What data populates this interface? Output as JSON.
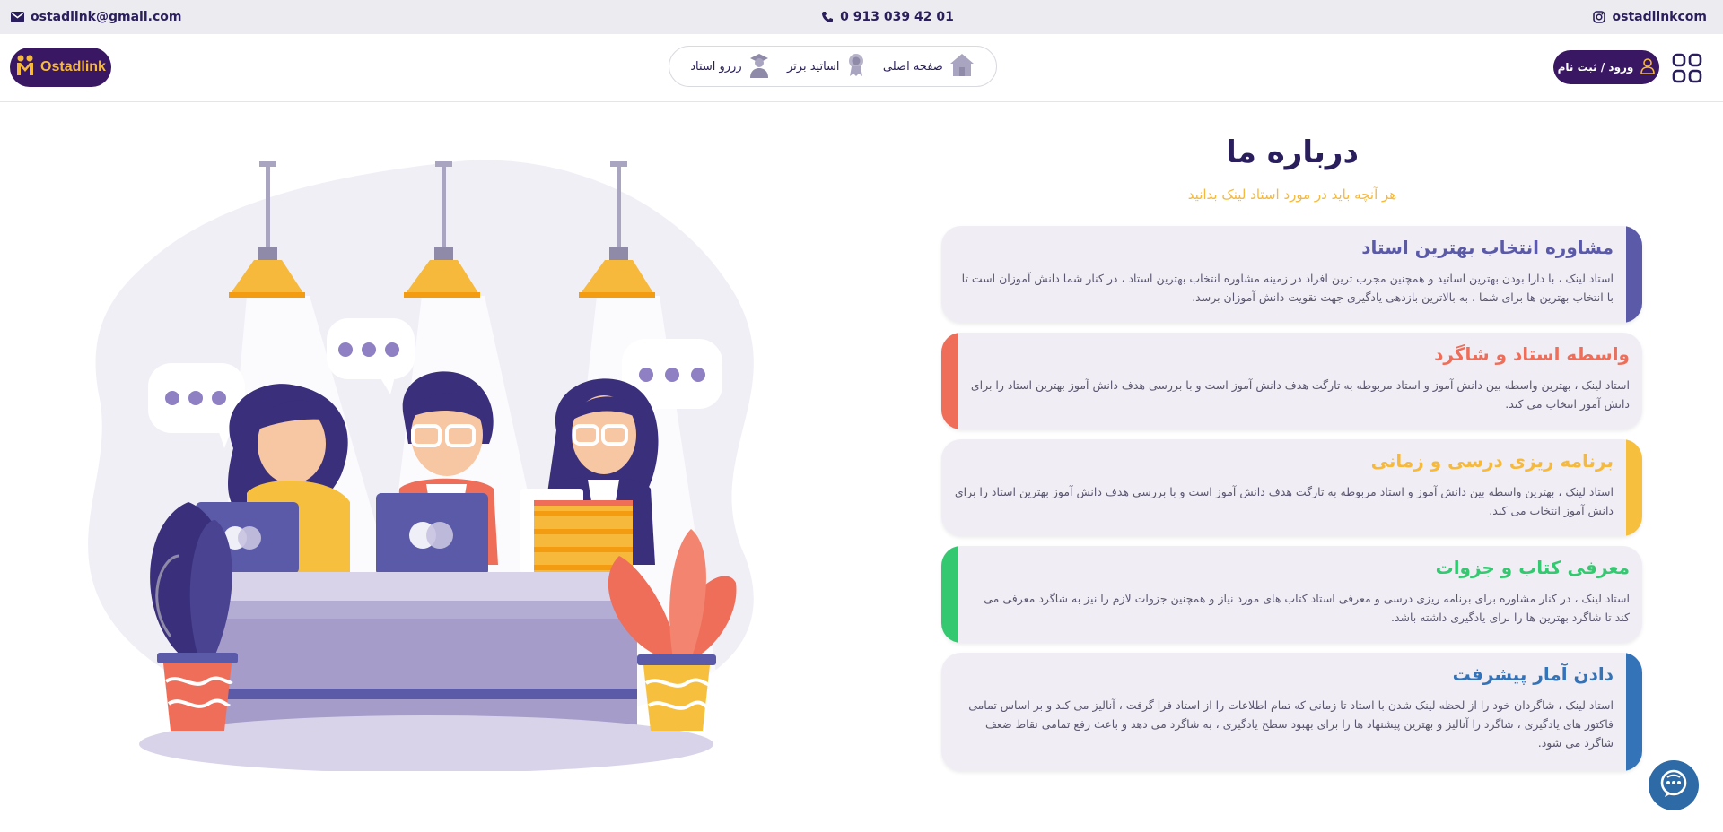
{
  "topbar": {
    "email": "ostadlink@gmail.com",
    "phone": "0 913 039 42 01",
    "instagram": "ostadlinkcom"
  },
  "header": {
    "logo_text": "Ostadlink",
    "nav": [
      {
        "label": "صفحه اصلی"
      },
      {
        "label": "اساتید برتر"
      },
      {
        "label": "رزرو استاد"
      }
    ],
    "login_label": "ورود / ثبت نام"
  },
  "about": {
    "title": "درباره ما",
    "subtitle": "هر آنچه باید در مورد استاد لینک بدانید",
    "cards": [
      {
        "title": "مشاوره انتخاب بهترین استاد",
        "text": "استاد لینک ، با دارا بودن بهترین اساتید و همچنین مجرب ترین افراد در زمینه مشاوره انتخاب بهترین استاد ، در کنار شما دانش آموزان است تا با انتخاب بهترین ها برای شما ، به بالاترین بازدهی یادگیری جهت تقویت دانش آموزان برسد.",
        "color": "#5b5aa8",
        "side": "right"
      },
      {
        "title": "واسطه استاد و شاگرد",
        "text": "استاد لینک ، بهترین واسطه بین دانش آموز و استاد مربوطه به تارگت هدف دانش آموز است و با بررسی هدف دانش آموز بهترین استاد را برای دانش آموز انتخاب می کند.",
        "color": "#ee6e5a",
        "side": "left"
      },
      {
        "title": "برنامه ریزی درسی و زمانی",
        "text": "استاد لینک ، بهترین واسطه بین دانش آموز و استاد مربوطه به تارگت هدف دانش آموز است و با بررسی هدف دانش آموز بهترین استاد را برای دانش آموز انتخاب می کند.",
        "color": "#f6c03e",
        "side": "right"
      },
      {
        "title": "معرفی کتاب و جزوات",
        "text": "استاد لینک ، در کنار مشاوره برای برنامه ریزی درسی و معرفی استاد کتاب های مورد نیاز و همچنین جزوات لازم را نیز به شاگرد معرفی می کند تا شاگرد بهترین ها را برای یادگیری داشته باشد.",
        "color": "#34c970",
        "side": "left"
      },
      {
        "title": "دادن آمار پیشرفت",
        "text": "استاد لینک ، شاگردان خود را از لحظه لینک شدن با استاد تا زمانی که تمام اطلاعات را از استاد فرا گرفت ، آنالیز می کند و بر اساس تمامی فاکتور های یادگیری ، شاگرد را آنالیز و بهترین پیشنهاد ها را برای بهبود سطح یادگیری ، به شاگرد می دهد و باعث رفع تمامی نقاط ضعف شاگرد می شود.",
        "color": "#3573b9",
        "side": "right"
      }
    ]
  },
  "colors": {
    "brand_dark": "#3a1763",
    "accent_yellow": "#f6b93b",
    "chat_blue": "#2d6aa6"
  }
}
